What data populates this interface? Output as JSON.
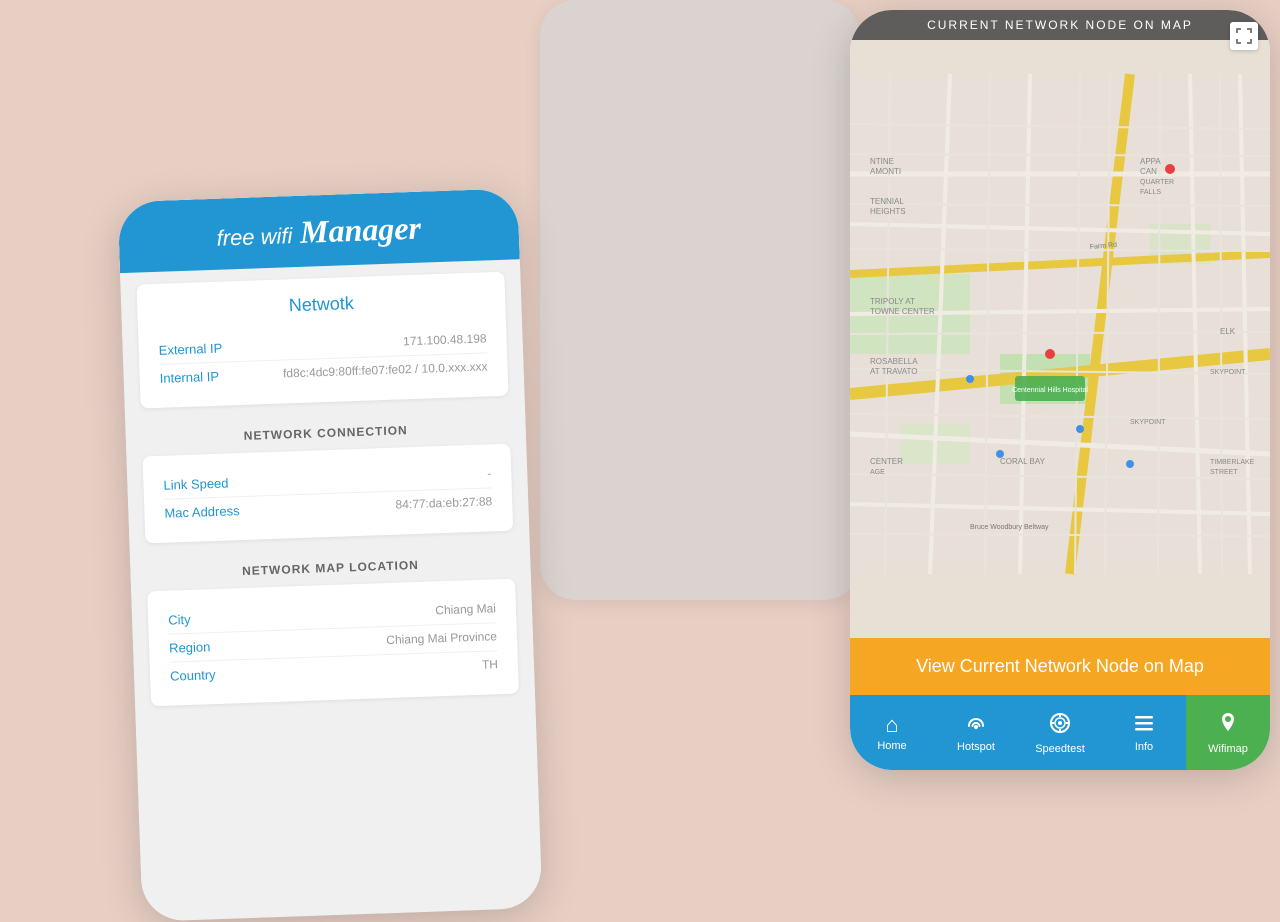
{
  "background": "#e8cfc4",
  "left_phone": {
    "header": {
      "free_wifi": "free wifi",
      "manager": "Manager"
    },
    "network_card": {
      "title": "Netwotk",
      "external_ip_label": "External IP",
      "external_ip_value": "171.100.48.198",
      "internal_ip_label": "Internal IP",
      "internal_ip_value": "fd8c:4dc9:80ff:fe07:fe02 / 10.0.xxx.xxx"
    },
    "network_connection": {
      "section_title": "NETWORK CONNECTION",
      "link_speed_label": "Link Speed",
      "link_speed_value": "-",
      "mac_address_label": "Mac Address",
      "mac_address_value": "84:77:da:eb:27:88"
    },
    "network_map": {
      "section_title": "NETWORK MAP LOCATION",
      "city_label": "City",
      "city_value": "Chiang Mai",
      "region_label": "Region",
      "region_value": "Chiang Mai Province",
      "country_label": "Country",
      "country_value": "TH"
    }
  },
  "right_phone": {
    "map_title": "CURRENT NETWORK NODE ON MAP",
    "view_button": "View Current Network Node on Map",
    "nav": {
      "home": "Home",
      "hotspot": "Hotspot",
      "speedtest": "Speedtest",
      "info": "Info",
      "wifimap": "Wifimap"
    }
  },
  "icons": {
    "home": "⌂",
    "hotspot": "📶",
    "speedtest": "◎",
    "info": "≡",
    "wifimap": "📍",
    "fullscreen": "⤢",
    "expand": "⛶"
  }
}
